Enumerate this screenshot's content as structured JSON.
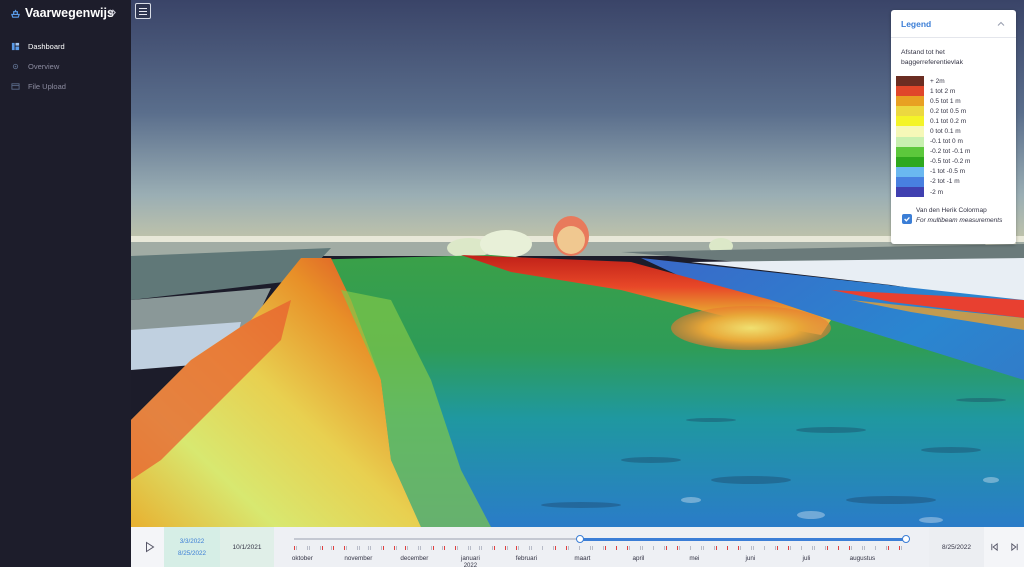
{
  "app": {
    "title": "Vaarwegenwijs"
  },
  "sidebar": {
    "items": [
      {
        "label": "Dashboard",
        "icon": "dashboard-icon",
        "active": true
      },
      {
        "label": "Overview",
        "icon": "overview-icon",
        "active": false
      },
      {
        "label": "File Upload",
        "icon": "file-upload-icon",
        "active": false
      }
    ]
  },
  "legend": {
    "title": "Legend",
    "subtitle": "Afstand tot het baggerreferentievlak",
    "entries": [
      {
        "label": "+ 2m",
        "color": "#6b2d22"
      },
      {
        "label": "1 tot 2 m",
        "color": "#e0462a"
      },
      {
        "label": "0.5 tot 1 m",
        "color": "#e8a022"
      },
      {
        "label": "0.2 tot 0.5 m",
        "color": "#ecd840"
      },
      {
        "label": "0.1 tot 0.2 m",
        "color": "#f4f428"
      },
      {
        "label": "0 tot 0.1 m",
        "color": "#f6f8b8"
      },
      {
        "label": "-0.1 tot 0 m",
        "color": "#c8f0b0"
      },
      {
        "label": "-0.2 tot -0.1 m",
        "color": "#5cc83c"
      },
      {
        "label": "-0.5 tot -0.2 m",
        "color": "#2ea81e"
      },
      {
        "label": "-1 tot -0.5 m",
        "color": "#6ab8f0"
      },
      {
        "label": "-2 tot -1 m",
        "color": "#4880e0"
      },
      {
        "label": "-2 m",
        "color": "#4040b0"
      }
    ],
    "colormap_label": "Van den Herik Colormap",
    "colormap_note": "For multibeam measurements",
    "colormap_checked": true
  },
  "timeline": {
    "selected_start": "3/3/2022",
    "selected_end": "8/25/2022",
    "range_start": "10/1/2021",
    "range_end": "8/25/2022",
    "months": [
      "oktober",
      "november",
      "december",
      "januari",
      "februari",
      "maart",
      "april",
      "mei",
      "juni",
      "juli",
      "augustus"
    ],
    "year_label": "2022",
    "accent": "#3b7ed6",
    "tick_color": "#e04040"
  }
}
